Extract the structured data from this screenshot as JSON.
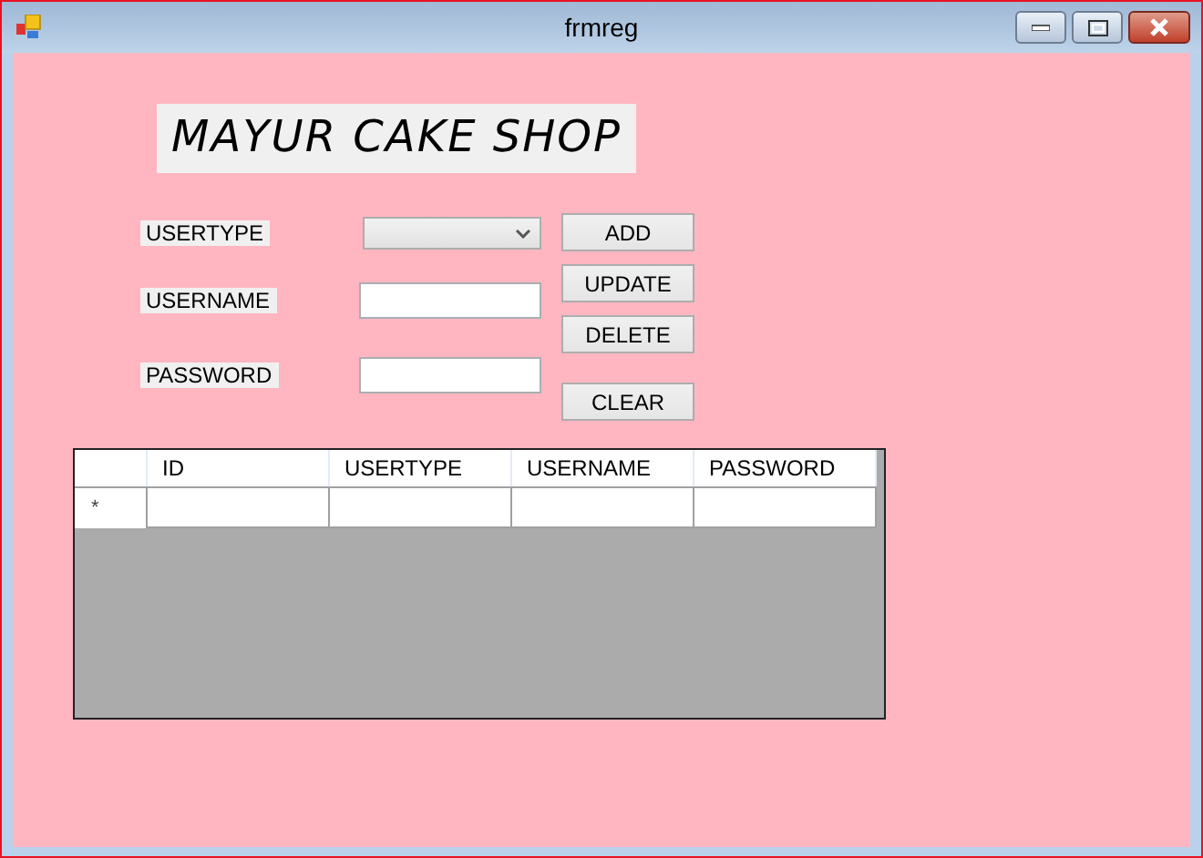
{
  "window": {
    "title": "frmreg"
  },
  "heading": "MAYUR CAKE SHOP",
  "fields": [
    {
      "label": "USERTYPE",
      "kind": "dropdown"
    },
    {
      "label": "USERNAME",
      "kind": "text"
    },
    {
      "label": "PASSWORD",
      "kind": "text"
    }
  ],
  "buttons": [
    "ADD",
    "UPDATE",
    "DELETE",
    "CLEAR"
  ],
  "table": {
    "columns": [
      "ID",
      "USERTYPE",
      "USERNAME",
      "PASSWORD"
    ],
    "new_row_marker": "*"
  }
}
